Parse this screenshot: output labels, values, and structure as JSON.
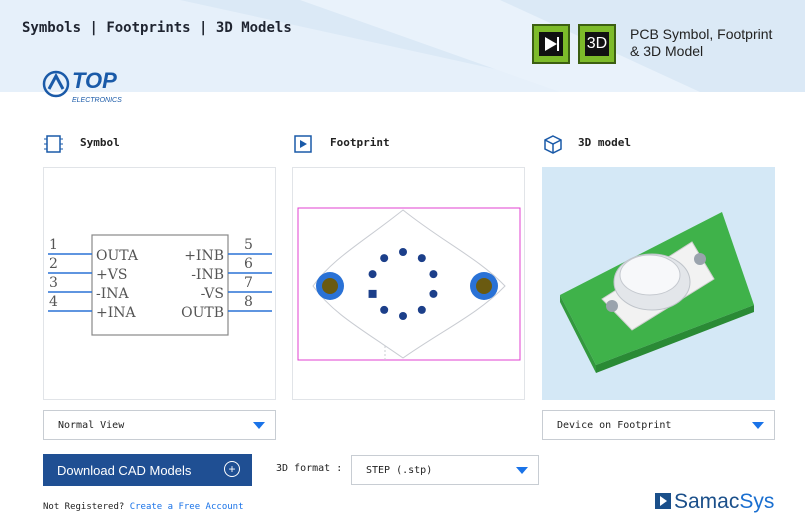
{
  "header": {
    "tab_symbols": "Symbols",
    "tab_footprints": "Footprints",
    "tab_3d_models": "3D Models",
    "separator": " | ",
    "banner_chip_3d": "3D",
    "banner_line1": "PCB Symbol, Footprint",
    "banner_line2": "& 3D Model"
  },
  "logo": {
    "brand": "TOP",
    "sub": "ELECTRONICS"
  },
  "sections": {
    "symbol_title": "Symbol",
    "footprint_title": "Footprint",
    "model_title": "3D model"
  },
  "symbol": {
    "pins_left": [
      {
        "num": "1",
        "name": "OUTA"
      },
      {
        "num": "2",
        "name": "+VS"
      },
      {
        "num": "3",
        "name": "-INA"
      },
      {
        "num": "4",
        "name": "+INA"
      }
    ],
    "pins_right": [
      {
        "num": "5",
        "name": "+INB"
      },
      {
        "num": "6",
        "name": "-INB"
      },
      {
        "num": "7",
        "name": "-VS"
      },
      {
        "num": "8",
        "name": "OUTB"
      }
    ]
  },
  "controls": {
    "view_select": "Normal View",
    "model_select": "Device on Footprint",
    "download_button": "Download CAD Models",
    "format_label": "3D format :",
    "format_select": "STEP (.stp)"
  },
  "footer": {
    "not_registered": "Not Registered?",
    "create_account": "Create a Free Account",
    "samac_a": "Samac",
    "samac_b": "Sys"
  },
  "colors": {
    "accent": "#1a73e8",
    "button": "#1f4f93",
    "pcb_green": "#3fb24a",
    "pin_blue": "#2a72d6"
  }
}
